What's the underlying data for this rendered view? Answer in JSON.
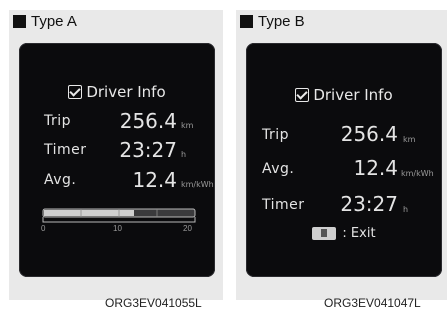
{
  "panels": [
    {
      "header": "Type A",
      "title": "Driver Info",
      "rows": [
        {
          "label": "Trip",
          "value": "256.4",
          "unit": "km"
        },
        {
          "label": "Timer",
          "value": "23:27",
          "unit": "h"
        },
        {
          "label": "Avg.",
          "value": "12.4",
          "unit": "km/kWh"
        }
      ],
      "gauge": {
        "ticks": [
          "0",
          "10",
          "20"
        ],
        "level": 0.6
      },
      "caption": "ORG3EV041055L"
    },
    {
      "header": "Type B",
      "title": "Driver Info",
      "rows": [
        {
          "label": "Trip",
          "value": "256.4",
          "unit": "km"
        },
        {
          "label": "Avg.",
          "value": "12.4",
          "unit": "km/kWh"
        },
        {
          "label": "Timer",
          "value": "23:27",
          "unit": "h"
        }
      ],
      "exit_label": ": Exit",
      "caption": "ORG3EV041047L"
    }
  ],
  "icons": {
    "title_icon": "checkbox-icon",
    "exit_icon": "button-icon"
  }
}
